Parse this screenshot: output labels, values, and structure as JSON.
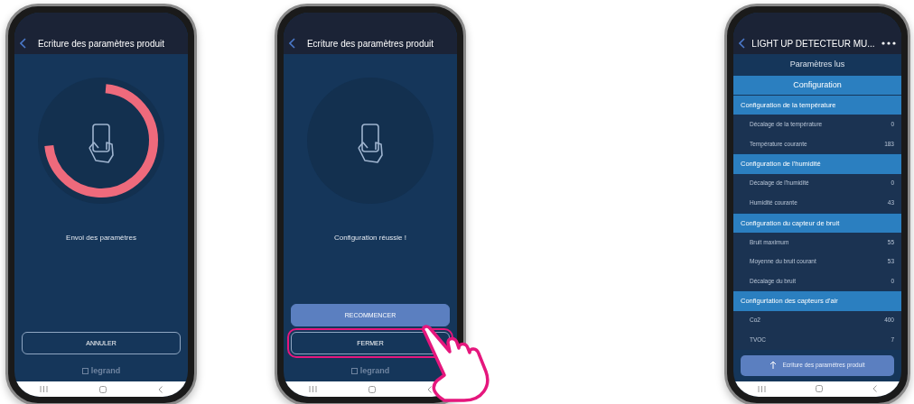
{
  "phones": [
    {
      "kind": "status",
      "title": "Ecriture des paramètres produit",
      "level": 0.72,
      "message": "Envoi des paramètres",
      "buttons": [
        {
          "label": "ANNULER",
          "kind": "outline",
          "highlighted": false
        }
      ],
      "brand": "legrand"
    },
    {
      "kind": "status",
      "title": "Ecriture des paramètres produit",
      "message": "Configuration réussie !",
      "buttons": [
        {
          "label": "RECOMMENCER",
          "kind": "filled",
          "highlighted": false
        },
        {
          "label": "FERMER",
          "kind": "outline",
          "highlighted": true
        }
      ],
      "brand": "legrand",
      "pointer": true
    },
    {
      "kind": "list",
      "title": "LIGHT UP DETECTEUR MU...",
      "subtitle": "Paramètres lus",
      "section": "Configuration",
      "groups": [
        {
          "title": "Configuration de la température",
          "rows": [
            {
              "label": "Décalage de la température",
              "value": "0"
            },
            {
              "label": "Température courante",
              "value": "183"
            }
          ]
        },
        {
          "title": "Configuration de l'humidité",
          "rows": [
            {
              "label": "Décalage de l'humidité",
              "value": "0"
            },
            {
              "label": "Humidité courante",
              "value": "43"
            }
          ]
        },
        {
          "title": "Configuration du capteur de bruit",
          "rows": [
            {
              "label": "Bruit maximum",
              "value": "55"
            },
            {
              "label": "Moyenne du bruit courant",
              "value": "53"
            },
            {
              "label": "Décalage du bruit",
              "value": "0"
            }
          ]
        },
        {
          "title": "Configurtation des capteurs d'air",
          "rows": [
            {
              "label": "Co2",
              "value": "400"
            },
            {
              "label": "TVOC",
              "value": "7"
            }
          ]
        }
      ],
      "action": "Ecriture des paramètres produit"
    }
  ]
}
